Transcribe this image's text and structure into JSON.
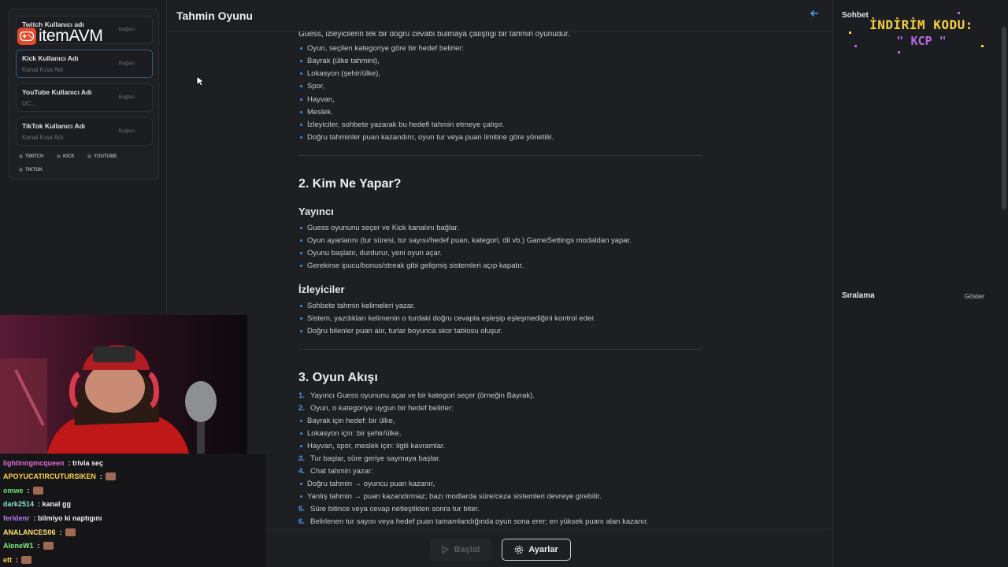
{
  "sidebar": {
    "accounts": [
      {
        "label": "Twitch Kullanıcı adı",
        "placeholder": "",
        "action": "Bağlan"
      },
      {
        "label": "Kick Kullanıcı Adı",
        "placeholder": "Kanal Kısa Adı",
        "action": "Bağlan"
      },
      {
        "label": "YouTube Kullanıcı Adı",
        "placeholder": "UC...",
        "action": "Bağlan"
      },
      {
        "label": "TikTok Kullanıcı Adı",
        "placeholder": "Kanal Kısa Adı",
        "action": "Bağlan"
      }
    ],
    "chips": [
      "TWITCH",
      "KICK",
      "YOUTUBE",
      "TIKTOK"
    ],
    "logo_text": "itemAVM"
  },
  "main": {
    "title": "Tahmin Oyunu",
    "intro": "Guess, izleyicilerin tek bir doğru cevabı bulmaya çalıştığı bir tahmin oyunudur.",
    "intro_items": [
      "Oyun, seçilen kategoriye göre bir hedef belirler:",
      "Bayrak (ülke tahmini),",
      "Lokasyon (şehir/ülke),",
      "Spor,",
      "Hayvan,",
      "Meslek.",
      "İzleyiciler, sohbete yazarak bu hedefi tahmin etmeye çalışır.",
      "Doğru tahminler puan kazandırır, oyun tur veya puan limitine göre yönetilir."
    ],
    "section2_title": "2. Kim Ne Yapar?",
    "streamer_title": "Yayıncı",
    "streamer_items": [
      "Guess oyununu seçer ve Kick kanalını bağlar.",
      "Oyun ayarlarını (tur süresi, tur sayısı/hedef puan, kategori, dil vb.) GameSettings modaldan yapar.",
      "Oyunu başlatır, durdurur, yeni oyun açar.",
      "Gerekirse ipucu/bonus/streak gibi gelişmiş sistemleri açıp kapatır."
    ],
    "viewers_title": "İzleyiciler",
    "viewer_items": [
      "Sohbete tahmin kelimeleri yazar.",
      "Sistem, yazdıkları kelimenin o turdaki doğru cevapla eşleşip eşleşmediğini kontrol eder.",
      "Doğru bilenler puan alır, turlar boyunca skor tablosu oluşur."
    ],
    "section3_title": "3. Oyun Akışı",
    "flow": [
      {
        "num": "1.",
        "text": "Yayıncı Guess oyununu açar ve bir kategori seçer (örneğin Bayrak)."
      },
      {
        "num": "2.",
        "text": "Oyun, o kategoriye uygun bir hedef belirler:"
      },
      {
        "num": "",
        "text": "Bayrak için hedef: bir ülke,"
      },
      {
        "num": "",
        "text": "Lokasyon için: bir şehir/ülke,"
      },
      {
        "num": "",
        "text": "Hayvan, spor, meslek için: ilgili kavramlar."
      },
      {
        "num": "3.",
        "text": "Tur başlar, süre geriye saymaya başlar."
      },
      {
        "num": "4.",
        "text": "Chat tahmin yazar:"
      },
      {
        "num": "",
        "text": "Doğru tahmin → oyuncu puan kazanır,"
      },
      {
        "num": "",
        "text": "Yanlış tahmin → puan kazandırmaz; bazı modlarda süre/ceza sistemleri devreye girebilir."
      },
      {
        "num": "5.",
        "text": "Süre bitince veya cevap netleştikten sonra tur biter."
      },
      {
        "num": "6.",
        "text": "Belirlenen tur sayısı veya hedef puan tamamlandığında oyun sona erer; en yüksek puanı alan kazanır."
      }
    ],
    "start_label": "Başlat",
    "settings_label": "Ayarlar"
  },
  "right": {
    "chat_title": "Sohbet",
    "promo_line1": "İNDİRİM KODU:",
    "promo_line2": "\" KCP \"",
    "ranking_title": "Sıralama",
    "ranking_show": "Göster"
  },
  "stream_chat": [
    {
      "user": "lightinngmcqueen",
      "color": "#e36bd0",
      "text": ": trivia seç",
      "emote": false
    },
    {
      "user": "APOYUCATIRCUTURSIKEN",
      "color": "#ffd24a",
      "text": ":",
      "emote": true
    },
    {
      "user": "omwe",
      "color": "#6fe06f",
      "text": ":",
      "emote": true
    },
    {
      "user": "dark2514",
      "color": "#8fe3c0",
      "text": ": kanal gg",
      "emote": false
    },
    {
      "user": "feridenr",
      "color": "#b67cf2",
      "text": ": bilmiyo ki naptıgını",
      "emote": false
    },
    {
      "user": "ANALANCES06",
      "color": "#ffe26a",
      "text": ":",
      "emote": true
    },
    {
      "user": "AloneW1",
      "color": "#7ff07f",
      "text": ":",
      "emote": true
    },
    {
      "user": "ett",
      "color": "#ffd24a",
      "text": ":",
      "emote": true
    }
  ],
  "colors": {
    "accent": "#4a9bf0",
    "logo": "#e14b2c",
    "promo_yellow": "#f4d23d",
    "promo_purple": "#b46ae0"
  }
}
